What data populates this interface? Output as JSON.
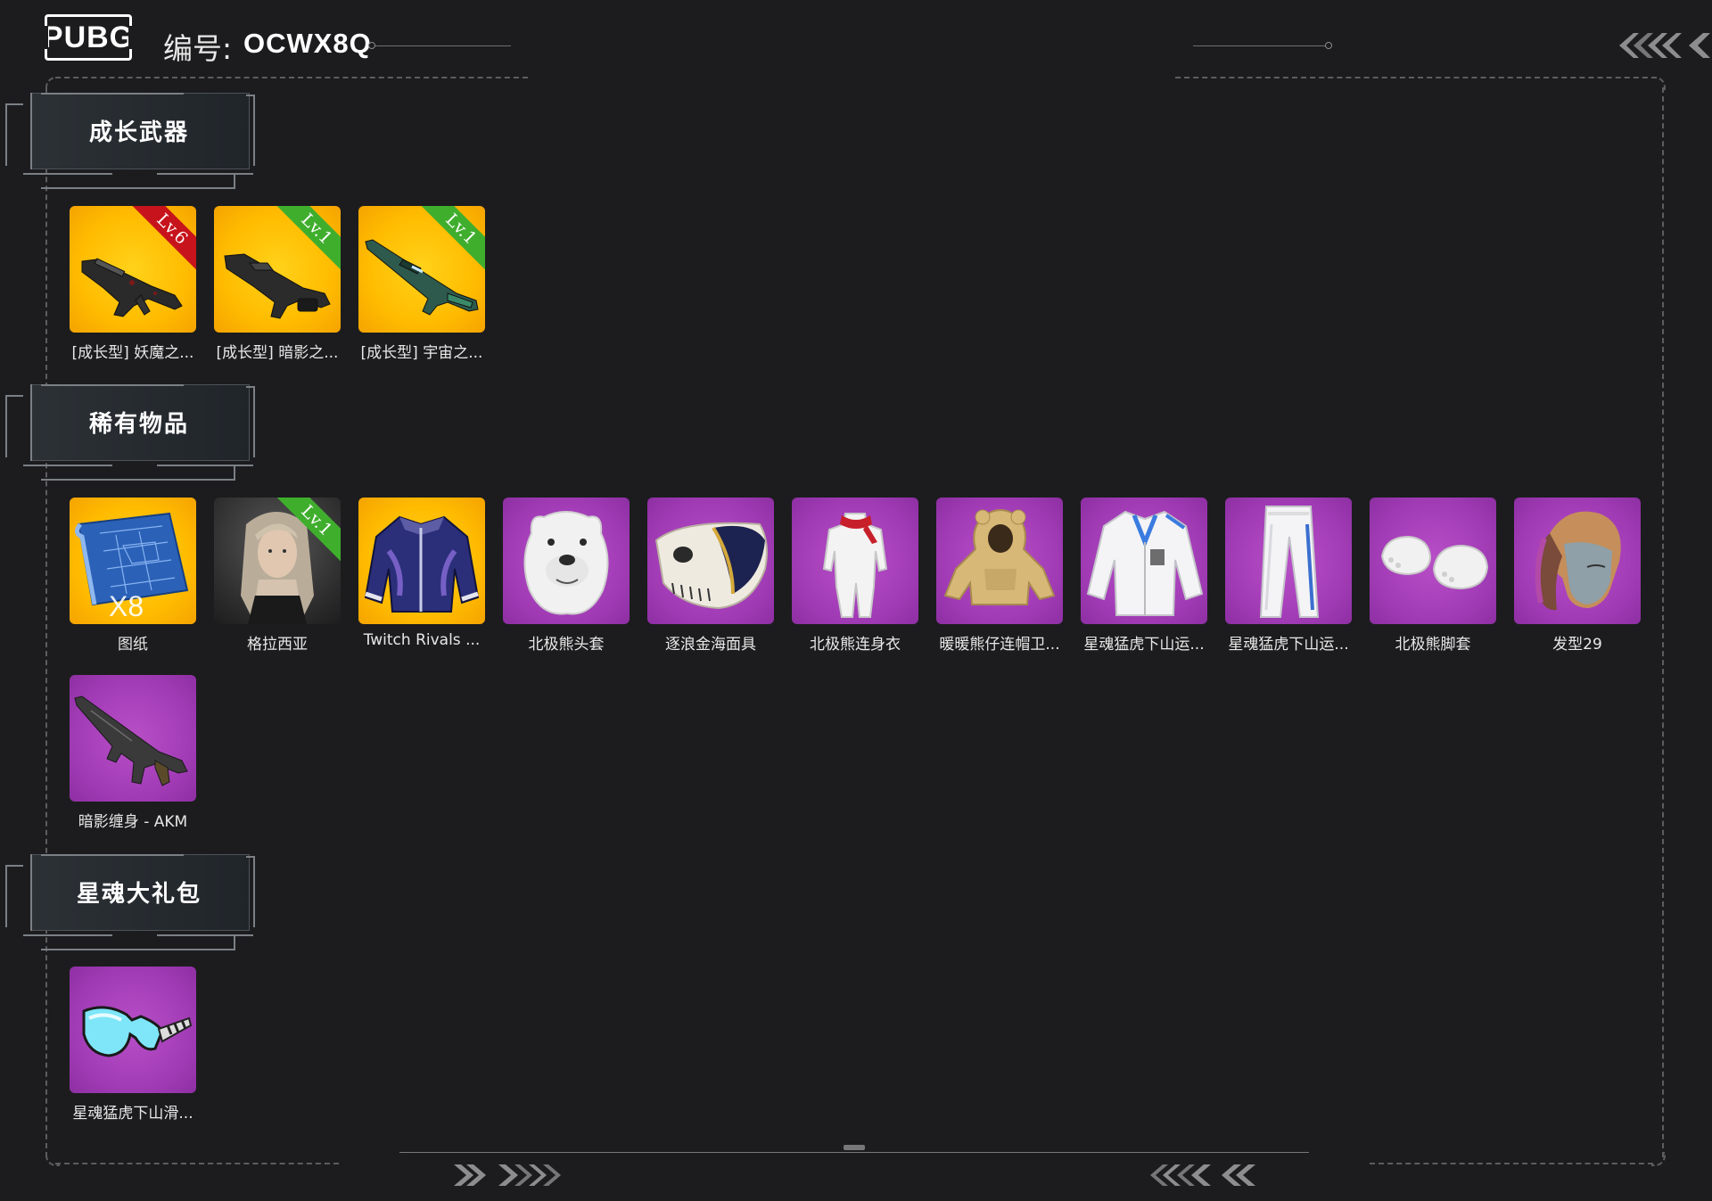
{
  "header": {
    "logo_text": "PUBG",
    "id_label": "编号:",
    "id_value": "OCWX8Q"
  },
  "sections": [
    {
      "title": "成长武器",
      "items": [
        {
          "name": "[成长型] 妖魔之...",
          "rarity": "gold",
          "badge": "Lv.6",
          "badge_color": "#c7131b",
          "icon": "rifle-icon"
        },
        {
          "name": "[成长型] 暗影之...",
          "rarity": "gold",
          "badge": "Lv.1",
          "badge_color": "#3fae2d",
          "icon": "lmg-icon"
        },
        {
          "name": "[成长型] 宇宙之...",
          "rarity": "gold",
          "badge": "Lv.1",
          "badge_color": "#3fae2d",
          "icon": "sniper-rifle-icon"
        }
      ]
    },
    {
      "title": "稀有物品",
      "items": [
        {
          "name": "图纸",
          "rarity": "gold",
          "overlay": "X8",
          "icon": "blueprint-icon"
        },
        {
          "name": "格拉西亚",
          "rarity": "dark",
          "badge": "Lv.1",
          "badge_color": "#3fae2d",
          "icon": "character-portrait-icon"
        },
        {
          "name": "Twitch Rivals ...",
          "rarity": "gold",
          "icon": "jacket-icon"
        },
        {
          "name": "北极熊头套",
          "rarity": "purple",
          "icon": "polar-bear-head-icon"
        },
        {
          "name": "逐浪金海面具",
          "rarity": "purple",
          "icon": "skull-mask-icon"
        },
        {
          "name": "北极熊连身衣",
          "rarity": "purple",
          "icon": "bodysuit-icon"
        },
        {
          "name": "暖暖熊仔连帽卫...",
          "rarity": "purple",
          "icon": "bear-hoodie-icon"
        },
        {
          "name": "星魂猛虎下山运...",
          "rarity": "purple",
          "icon": "sport-jacket-icon"
        },
        {
          "name": "星魂猛虎下山运...",
          "rarity": "purple",
          "icon": "sport-pants-icon"
        },
        {
          "name": "北极熊脚套",
          "rarity": "purple",
          "icon": "paw-shoes-icon"
        },
        {
          "name": "发型29",
          "rarity": "purple",
          "icon": "hairstyle-icon"
        },
        {
          "name": "暗影缠身 - AKM",
          "rarity": "purple",
          "icon": "akm-icon"
        }
      ]
    },
    {
      "title": "星魂大礼包",
      "items": [
        {
          "name": "星魂猛虎下山滑...",
          "rarity": "purple",
          "icon": "goggles-icon"
        }
      ]
    }
  ]
}
